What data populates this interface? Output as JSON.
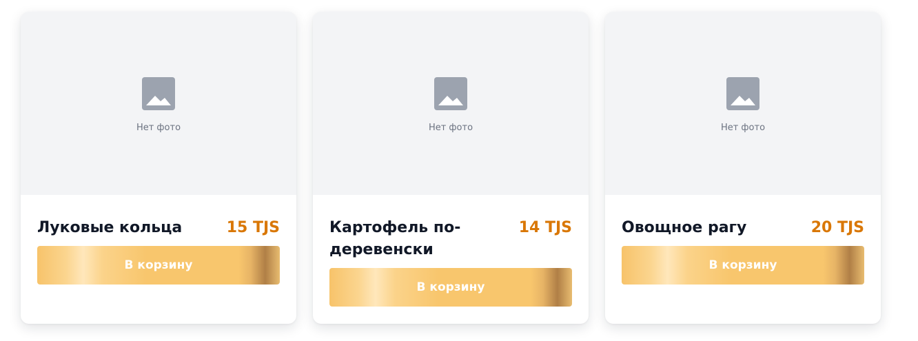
{
  "products": [
    {
      "name": "Луковые кольца",
      "price": "15 TJS",
      "no_photo": "Нет фото",
      "button": "В корзину"
    },
    {
      "name": "Картофель по-деревенски",
      "price": "14 TJS",
      "no_photo": "Нет фото",
      "button": "В корзину"
    },
    {
      "name": "Овощное рагу",
      "price": "20 TJS",
      "no_photo": "Нет фото",
      "button": "В корзину"
    }
  ],
  "colors": {
    "price": "#d97706",
    "placeholder_bg": "#f3f4f6",
    "placeholder_icon": "#9ca3af",
    "button_gold": "#f8c66d"
  },
  "icons": {
    "placeholder": "image-placeholder-icon"
  }
}
